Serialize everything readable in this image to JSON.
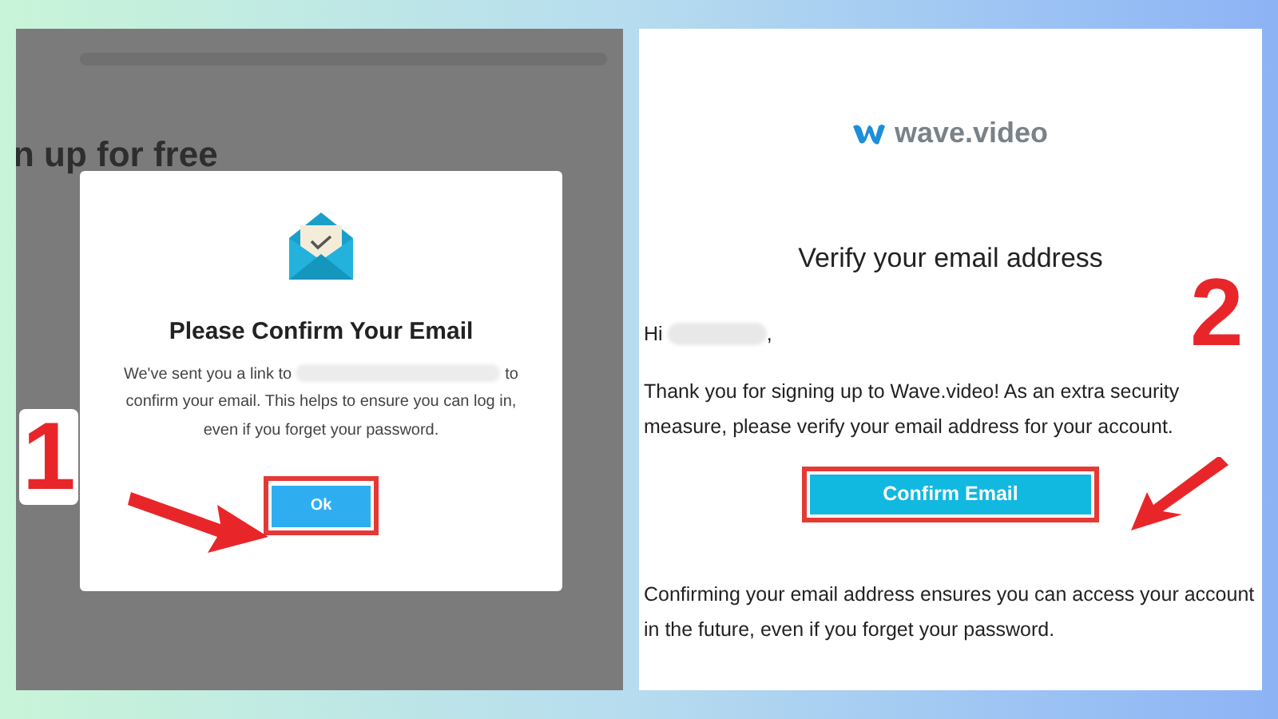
{
  "left_screen": {
    "background_page": {
      "heading": "n up for free"
    },
    "dialog": {
      "title": "Please Confirm Your Email",
      "message_before": "We've sent you a link to",
      "message_after": "to confirm your email. This helps to ensure you can log in, even if you forget your password.",
      "button": "Ok"
    },
    "step": "1"
  },
  "right_screen": {
    "logo": "wave.video",
    "heading": "Verify your email address",
    "greeting_before": "Hi",
    "greeting_after": ",",
    "paragraph": "Thank you for signing up to Wave.video! As an extra security measure, please verify your email address for your account.",
    "button": "Confirm Email",
    "footer": "Confirming your email address ensures you can access your account in the future, even if you forget your password.",
    "step": "2"
  }
}
